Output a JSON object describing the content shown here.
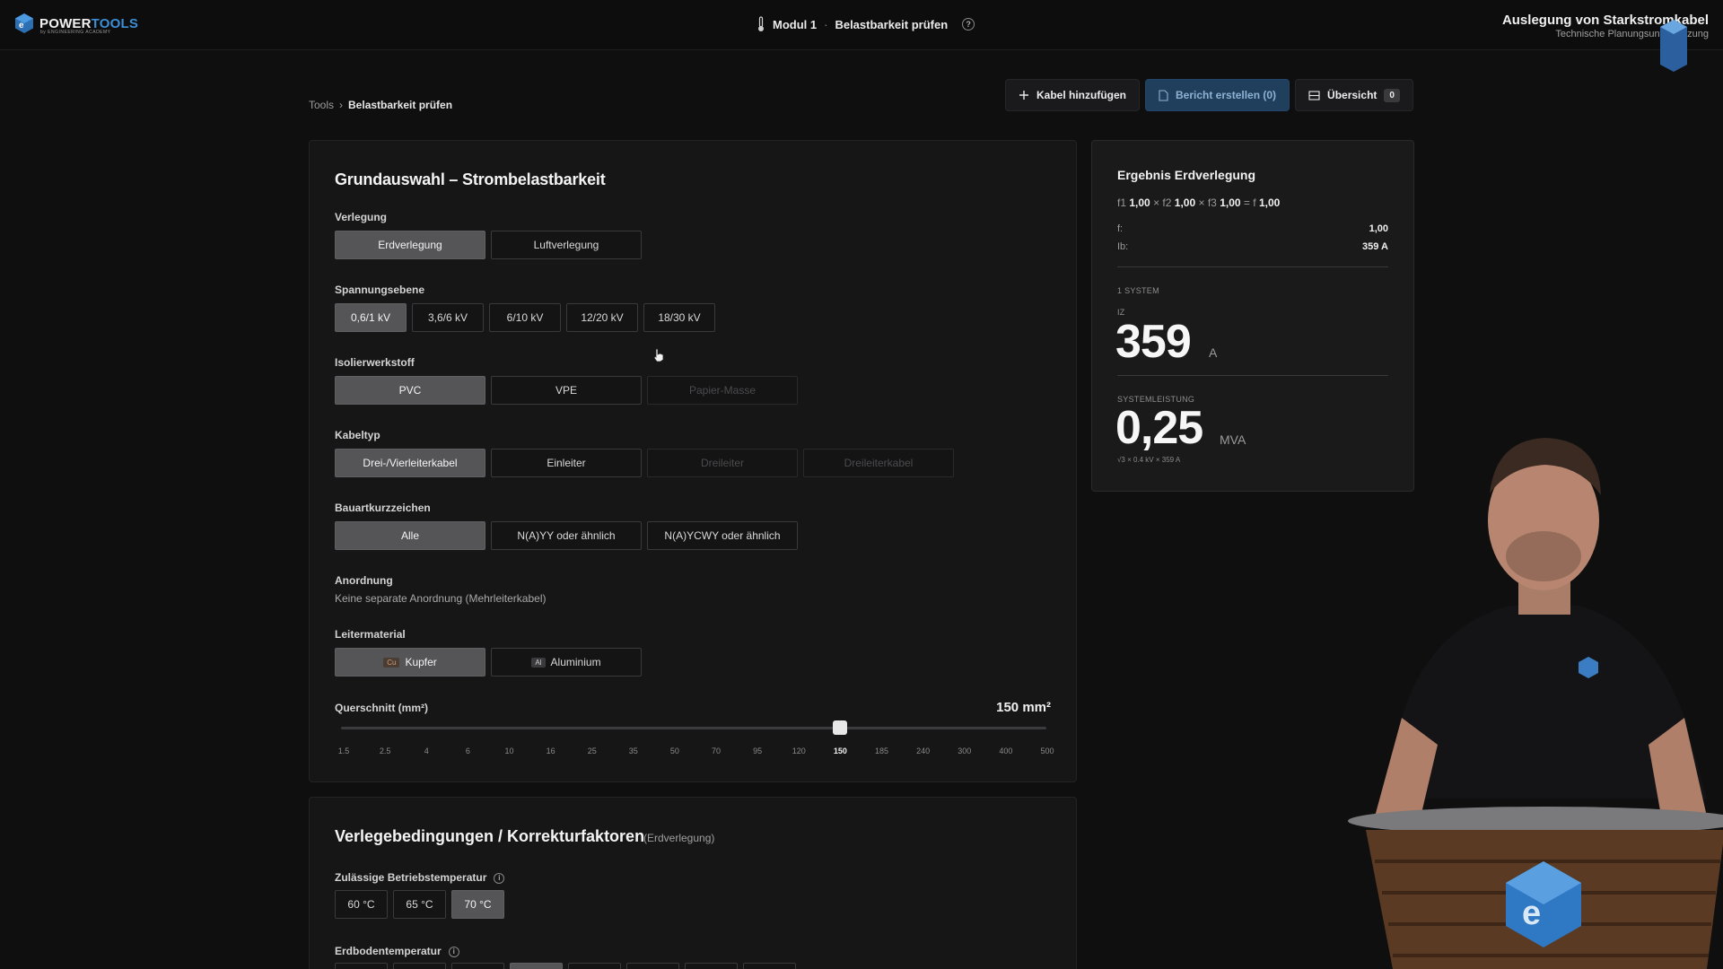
{
  "app": {
    "logo_main": "POWER",
    "logo_accent": "TOOLS",
    "logo_sub": "by ENGINEERING ACADEMY"
  },
  "header": {
    "module": "Modul 1",
    "separator": "·",
    "page": "Belastbarkeit prüfen",
    "help": "?",
    "right_title": "Auslegung von Starkstromkabel",
    "right_subtitle": "Technische Planungsunterstützung"
  },
  "breadcrumb": {
    "root": "Tools",
    "separator": "›",
    "current": "Belastbarkeit prüfen"
  },
  "actions": {
    "add_cable": "Kabel hinzufügen",
    "create_report": "Bericht erstellen (0)",
    "overview": "Übersicht",
    "overview_count": "0"
  },
  "main": {
    "title": "Grundauswahl – Strombelastbarkeit",
    "verlegung": {
      "label": "Verlegung",
      "options": [
        "Erdverlegung",
        "Luftverlegung"
      ],
      "selected": 0
    },
    "spannung": {
      "label": "Spannungsebene",
      "options": [
        "0,6/1 kV",
        "3,6/6 kV",
        "6/10 kV",
        "12/20 kV",
        "18/30 kV"
      ],
      "selected": 0
    },
    "isolier": {
      "label": "Isolierwerkstoff",
      "options": [
        "PVC",
        "VPE",
        "Papier-Masse"
      ],
      "selected": 0,
      "disabled": [
        2
      ]
    },
    "kabeltyp": {
      "label": "Kabeltyp",
      "options": [
        "Drei-/Vierleiterkabel",
        "Einleiter",
        "Dreileiter",
        "Dreileiterkabel"
      ],
      "selected": 0,
      "disabled": [
        2,
        3
      ]
    },
    "bauart": {
      "label": "Bauartkurzzeichen",
      "options": [
        "Alle",
        "N(A)YY oder ähnlich",
        "N(A)YCWY oder ähnlich"
      ],
      "selected": 0
    },
    "anordnung": {
      "label": "Anordnung",
      "text": "Keine separate Anordnung (Mehrleiterkabel)"
    },
    "leiter": {
      "label": "Leitermaterial",
      "options": [
        {
          "tag": "Cu",
          "label": "Kupfer"
        },
        {
          "tag": "Al",
          "label": "Aluminium"
        }
      ],
      "selected": 0
    },
    "querschnitt": {
      "label": "Querschnitt (mm²)",
      "value_text": "150 mm²",
      "ticks": [
        "1.5",
        "2.5",
        "4",
        "6",
        "10",
        "16",
        "25",
        "35",
        "50",
        "70",
        "95",
        "120",
        "150",
        "185",
        "240",
        "300",
        "400",
        "500"
      ],
      "selected_index": 12
    }
  },
  "section2": {
    "title": "Verlegebedingungen / Korrekturfaktoren",
    "subtitle": "(Erdverlegung)",
    "temp_label": "Zulässige Betriebstemperatur",
    "temp_options": [
      "60 °C",
      "65 °C",
      "70 °C"
    ],
    "temp_selected": 2,
    "soil_label": "Erdbodentemperatur",
    "info": "i"
  },
  "result": {
    "title": "Ergebnis Erdverlegung",
    "f1_label": "f1",
    "f1": "1,00",
    "x1": "×",
    "f2_label": "f2",
    "f2": "1,00",
    "x2": "×",
    "f3_label": "f3",
    "f3": "1,00",
    "eq": "=",
    "f_label": "f",
    "f": "1,00",
    "row_f_label": "f:",
    "row_f_value": "1,00",
    "row_ib_label": "Ib:",
    "row_ib_value": "359 A",
    "systems": "1 SYSTEM",
    "iz_label": "IZ",
    "iz_value": "359",
    "iz_unit": "A",
    "power_label": "SYSTEMLEISTUNG",
    "power_value": "0,25",
    "power_unit": "MVA",
    "power_formula": "√3 × 0.4 kV × 359 A"
  },
  "colors": {
    "accent": "#3c8fd6",
    "primary_button": "#1f3f5d",
    "active_segment": "#555557"
  }
}
